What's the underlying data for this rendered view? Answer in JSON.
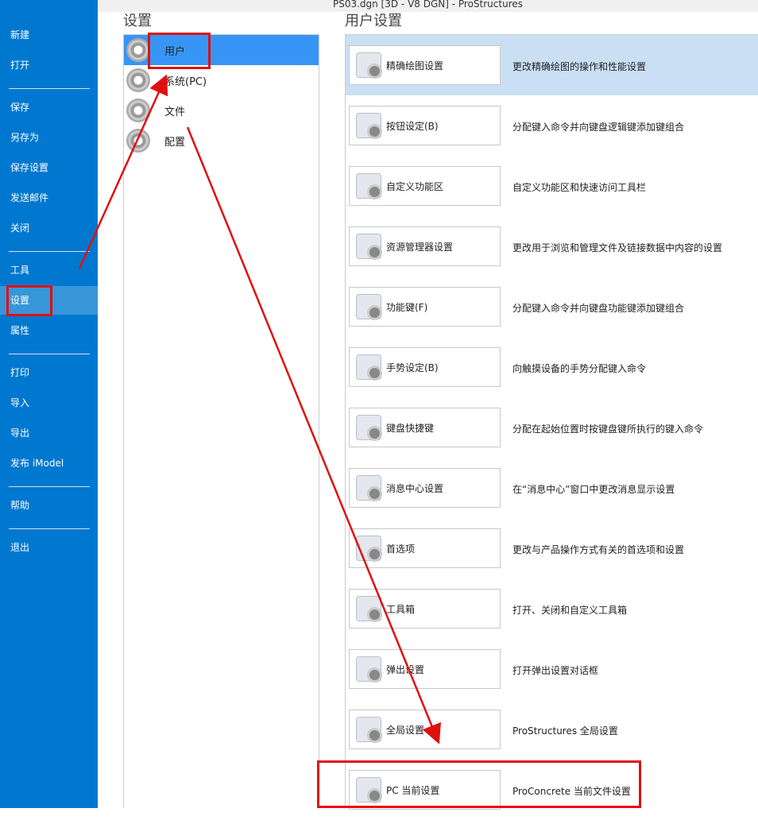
{
  "window_title": "PS03.dgn [3D - V8 DGN] - ProStructures",
  "sidebar": {
    "items": [
      "新建",
      "打开",
      "保存",
      "另存为",
      "保存设置",
      "发送邮件",
      "关闭",
      "工具",
      "设置",
      "属性",
      "打印",
      "导入",
      "导出",
      "发布 iModel",
      "帮助",
      "退出"
    ],
    "selected": "设置"
  },
  "categories": {
    "header": "设置",
    "items": [
      "用户",
      "系统(PC)",
      "文件",
      "配置"
    ],
    "selected": "用户"
  },
  "user_settings": {
    "header": "用户设置",
    "items": [
      {
        "label": "精确绘图设置",
        "desc": "更改精确绘图的操作和性能设置",
        "icon": "accudraw-icon"
      },
      {
        "label": "按钮设定(B)",
        "desc": "分配键入命令并向键盘逻辑键添加键组合",
        "icon": "mouse-icon"
      },
      {
        "label": "自定义功能区",
        "desc": "自定义功能区和快速访问工具栏",
        "icon": "ribbon-icon"
      },
      {
        "label": "资源管理器设置",
        "desc": "更改用于浏览和管理文件及链接数据中内容的设置",
        "icon": "explorer-icon"
      },
      {
        "label": "功能键(F)",
        "desc": "分配键入命令并向键盘功能键添加键组合",
        "icon": "function-key-icon"
      },
      {
        "label": "手势设定(B)",
        "desc": "向触摸设备的手势分配键入命令",
        "icon": "gesture-icon"
      },
      {
        "label": "键盘快捷键",
        "desc": "分配在起始位置时按键盘键所执行的键入命令",
        "icon": "keyboard-icon"
      },
      {
        "label": "消息中心设置",
        "desc": "在“消息中心”窗口中更改消息显示设置",
        "icon": "message-center-icon"
      },
      {
        "label": "首选项",
        "desc": "更改与产品操作方式有关的首选项和设置",
        "icon": "preferences-icon"
      },
      {
        "label": "工具箱",
        "desc": "打开、关闭和自定义工具箱",
        "icon": "toolbox-icon"
      },
      {
        "label": "弹出设置",
        "desc": "打开弹出设置对话框",
        "icon": "popup-icon"
      },
      {
        "label": "全局设置",
        "desc": "ProStructures 全局设置",
        "icon": "global-settings-icon"
      },
      {
        "label": "PC 当前设置",
        "desc": "ProConcrete 当前文件设置",
        "icon": "pc-current-settings-icon"
      }
    ]
  },
  "annotation_color": "#e01010"
}
